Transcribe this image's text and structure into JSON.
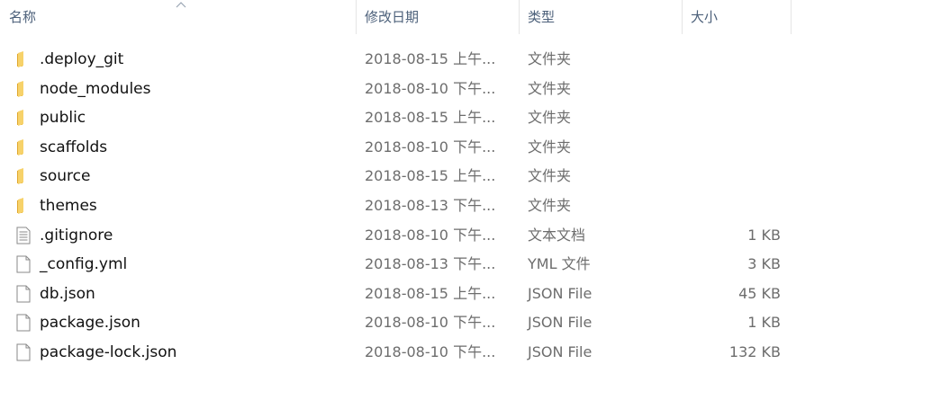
{
  "header": {
    "name": "名称",
    "date": "修改日期",
    "type": "类型",
    "size": "大小"
  },
  "colors": {
    "header_text": "#4c607a",
    "folder": "#f2c54a",
    "text_primary": "#111111",
    "text_secondary": "#6d6d6d"
  },
  "items": [
    {
      "name": ".deploy_git",
      "date": "2018-08-15 上午...",
      "type": "文件夹",
      "size": "",
      "icon": "folder-icon"
    },
    {
      "name": "node_modules",
      "date": "2018-08-10 下午...",
      "type": "文件夹",
      "size": "",
      "icon": "folder-icon"
    },
    {
      "name": "public",
      "date": "2018-08-15 上午...",
      "type": "文件夹",
      "size": "",
      "icon": "folder-icon"
    },
    {
      "name": "scaffolds",
      "date": "2018-08-10 下午...",
      "type": "文件夹",
      "size": "",
      "icon": "folder-icon"
    },
    {
      "name": "source",
      "date": "2018-08-15 上午...",
      "type": "文件夹",
      "size": "",
      "icon": "folder-icon"
    },
    {
      "name": "themes",
      "date": "2018-08-13 下午...",
      "type": "文件夹",
      "size": "",
      "icon": "folder-icon"
    },
    {
      "name": ".gitignore",
      "date": "2018-08-10 下午...",
      "type": "文本文档",
      "size": "1 KB",
      "icon": "text-document-icon"
    },
    {
      "name": "_config.yml",
      "date": "2018-08-13 下午...",
      "type": "YML 文件",
      "size": "3 KB",
      "icon": "file-icon"
    },
    {
      "name": "db.json",
      "date": "2018-08-15 上午...",
      "type": "JSON File",
      "size": "45 KB",
      "icon": "file-icon"
    },
    {
      "name": "package.json",
      "date": "2018-08-10 下午...",
      "type": "JSON File",
      "size": "1 KB",
      "icon": "file-icon"
    },
    {
      "name": "package-lock.json",
      "date": "2018-08-10 下午...",
      "type": "JSON File",
      "size": "132 KB",
      "icon": "file-icon"
    }
  ]
}
